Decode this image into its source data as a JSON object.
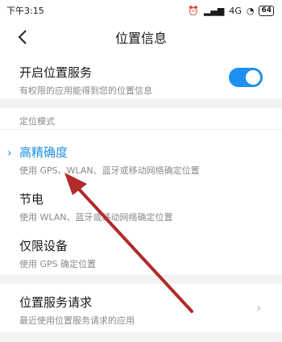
{
  "status_bar": {
    "time": "下午3:15",
    "network": "4G",
    "battery": "64"
  },
  "header": {
    "title": "位置信息",
    "back_icon": "chevron-left-icon"
  },
  "location_service": {
    "title": "开启位置服务",
    "subtitle": "有权限的应用能得到您的位置信息",
    "enabled": true,
    "toggle_color": "#1e90f0"
  },
  "modes": {
    "section_label": "定位模式",
    "items": [
      {
        "title": "高精确度",
        "subtitle": "使用 GPS、WLAN、蓝牙或移动网络确定位置",
        "selected": true
      },
      {
        "title": "节电",
        "subtitle": "使用 WLAN、蓝牙或移动网络确定位置",
        "selected": false
      },
      {
        "title": "仅限设备",
        "subtitle": "使用 GPS 确定位置",
        "selected": false
      }
    ]
  },
  "requests": {
    "title": "位置服务请求",
    "subtitle": "最近使用位置服务请求的应用"
  },
  "colors": {
    "accent": "#1e8fe6",
    "annotation_arrow": "#b22a2a"
  }
}
